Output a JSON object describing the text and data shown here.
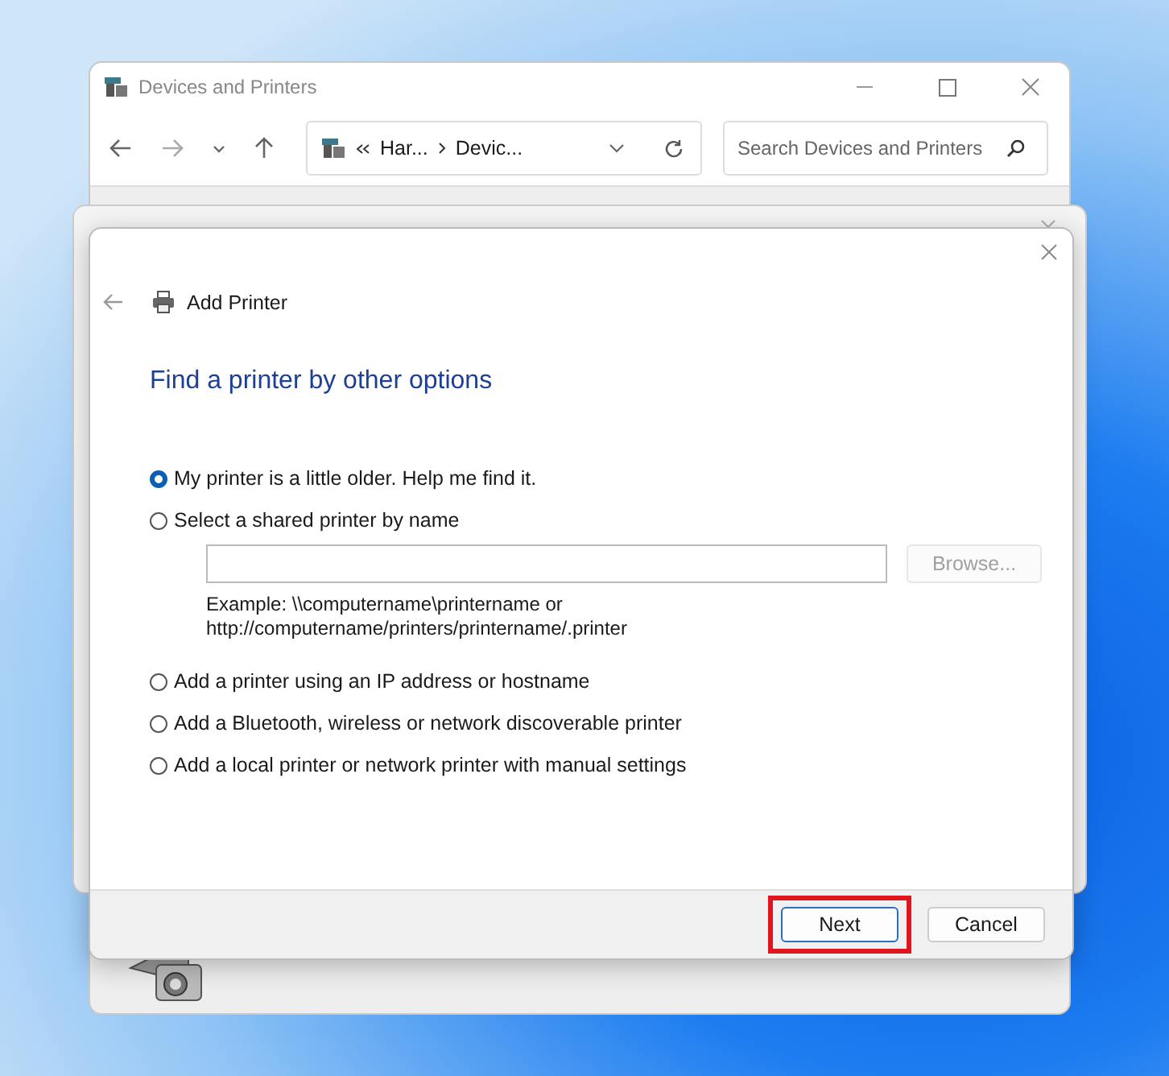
{
  "explorer": {
    "title": "Devices and Printers",
    "breadcrumb": [
      "Har...",
      "Devic..."
    ],
    "search": {
      "placeholder": "Search Devices and Printers"
    }
  },
  "dialog": {
    "title": "Add Printer",
    "heading": "Find a printer by other options",
    "options": [
      {
        "label": "My printer is a little older. Help me find it.",
        "selected": true
      },
      {
        "label": "Select a shared printer by name",
        "selected": false,
        "browse_button": {
          "label": "Browse...",
          "disabled": true
        },
        "example": [
          "Example: \\\\computername\\printername or",
          "http://computername/printers/printername/.printer"
        ]
      },
      {
        "label": "Add a printer using an IP address or hostname",
        "selected": false
      },
      {
        "label": "Add a Bluetooth, wireless or network discoverable printer",
        "selected": false
      },
      {
        "label": "Add a local printer or network printer with manual settings",
        "selected": false
      }
    ],
    "buttons": [
      {
        "label": "Next",
        "default": true,
        "highlighted": true
      },
      {
        "label": "Cancel",
        "default": false,
        "highlighted": false
      }
    ]
  }
}
